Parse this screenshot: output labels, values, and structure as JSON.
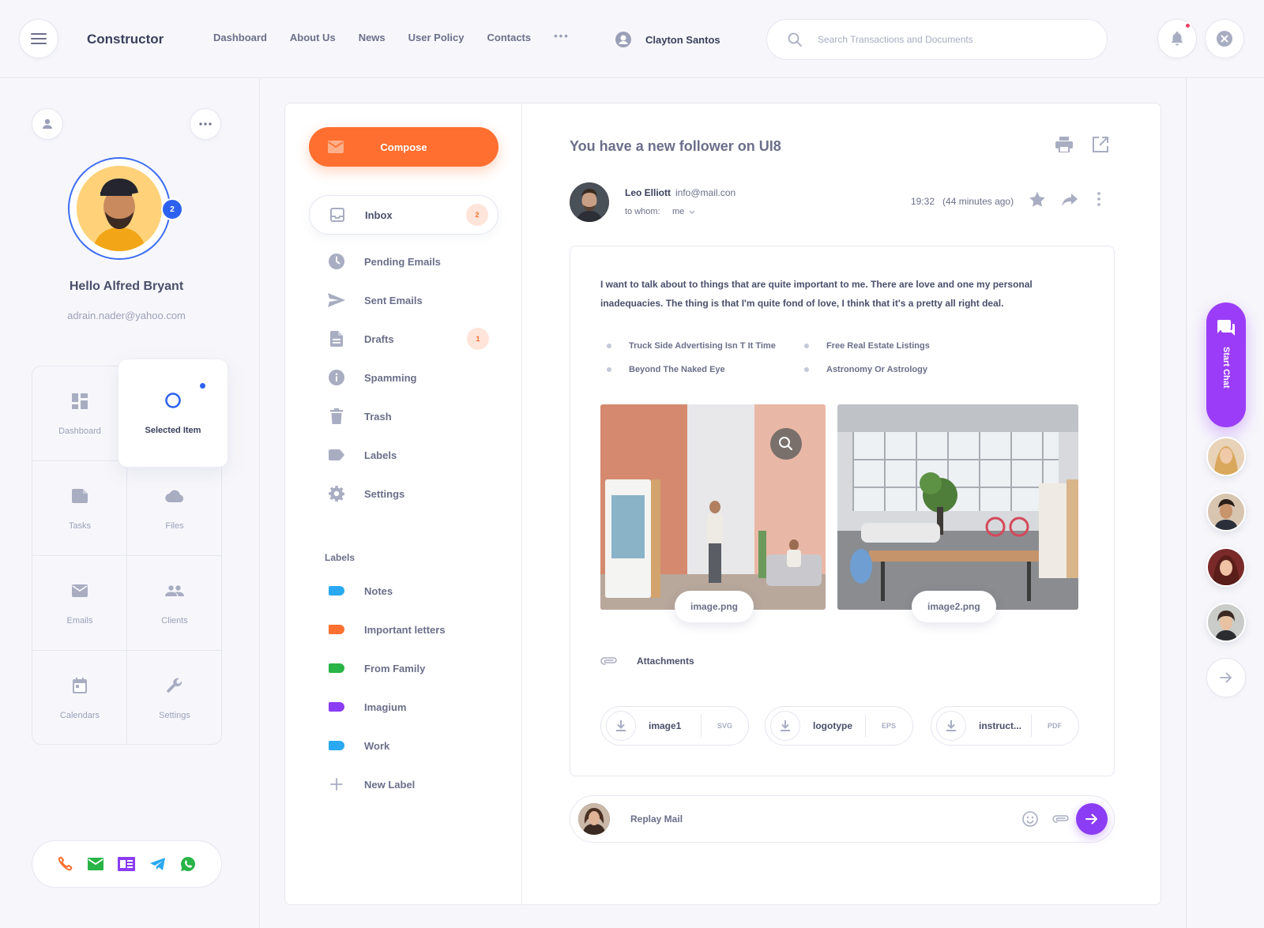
{
  "topbar": {
    "brand": "Constructor",
    "nav": [
      "Dashboard",
      "About Us",
      "News",
      "User Policy",
      "Contacts"
    ],
    "more": "•••",
    "user_name": "Clayton Santos",
    "search_placeholder": "Search Transactions and Documents"
  },
  "profile": {
    "badge": "2",
    "greeting": "Hello Alfred Bryant",
    "email": "adrain.nader@yahoo.com"
  },
  "grid_nav": {
    "dashboard": "Dashboard",
    "selected": "Selected Item",
    "tasks": "Tasks",
    "files": "Files",
    "emails": "Emails",
    "clients": "Clients",
    "calendars": "Calendars",
    "settings": "Settings"
  },
  "mail": {
    "compose": "Compose",
    "folders": [
      {
        "label": "Inbox",
        "count": "2"
      },
      {
        "label": "Pending Emails"
      },
      {
        "label": "Sent Emails"
      },
      {
        "label": "Drafts",
        "count": "1"
      },
      {
        "label": "Spamming"
      },
      {
        "label": "Trash"
      },
      {
        "label": "Labels"
      },
      {
        "label": "Settings"
      }
    ],
    "labels_heading": "Labels",
    "labels": [
      {
        "label": "Notes",
        "color": "#2aa8f2"
      },
      {
        "label": "Important letters",
        "color": "#ff6f2f"
      },
      {
        "label": "From Family",
        "color": "#28b446"
      },
      {
        "label": "Imagium",
        "color": "#8b3df5"
      },
      {
        "label": "Work",
        "color": "#2aa8f2"
      }
    ],
    "new_label": "New Label"
  },
  "message": {
    "title": "You have a new follower on UI8",
    "sender_name": "Leo Elliott",
    "sender_email": "info@mail.con",
    "to_label": "to whom:",
    "to_value": "me",
    "time": "19:32",
    "time_ago": "(44 minutes ago)",
    "body": "I want to talk about to things that are quite important to me. There are love and one my personal inadequacies. The thing is that I'm quite fond of love, I think that it's a pretty all right deal.",
    "bullets": [
      "Truck Side Advertising Isn T It Time",
      "Free Real Estate Listings",
      "Beyond The Naked Eye",
      "Astronomy Or Astrology"
    ],
    "images": [
      "image.png",
      "image2.png"
    ],
    "attachments_heading": "Attachments",
    "attachments": [
      {
        "name": "image1",
        "ext": "SVG"
      },
      {
        "name": "logotype",
        "ext": "EPS"
      },
      {
        "name": "instruct...",
        "ext": "PDF"
      }
    ],
    "reply_placeholder": "Replay Mail"
  },
  "right_rail": {
    "start_chat": "Start Chat"
  },
  "colors": {
    "accent_orange": "#ff6f2f",
    "accent_purple": "#8b3df5",
    "accent_blue": "#2d62f0"
  }
}
